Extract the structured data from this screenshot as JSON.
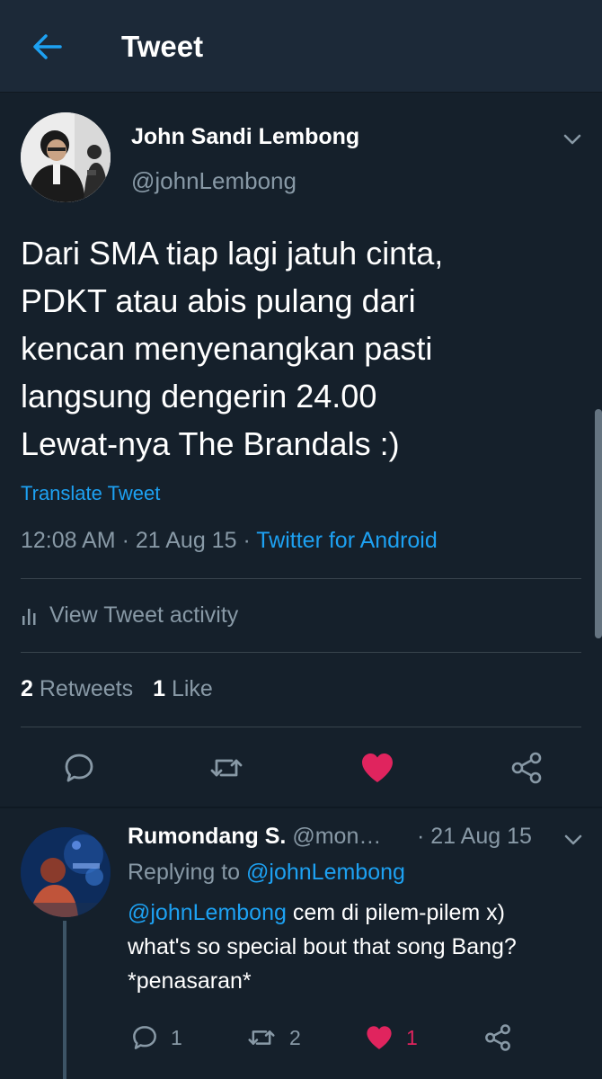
{
  "topbar": {
    "title": "Tweet",
    "back_icon": "arrow-left-icon"
  },
  "tweet": {
    "author_name": "John Sandi Lembong",
    "author_handle": "@johnLembong",
    "text_lines": [
      "Dari SMA tiap lagi jatuh cinta,",
      "PDKT atau abis pulang dari",
      "kencan menyenangkan pasti",
      "langsung dengerin 24.00",
      "Lewat-nya The Brandals :)"
    ],
    "translate_label": "Translate Tweet",
    "time": "12:08 AM",
    "date": "21 Aug 15",
    "source": "Twitter for Android",
    "activity_label": "View Tweet activity",
    "retweet_count": "2",
    "retweets_label": "Retweets",
    "like_count": "1",
    "like_label": "Like",
    "liked": true
  },
  "reply": {
    "author_name": "Rumondang S.",
    "author_handle": "@mon…",
    "date": "· 21 Aug 15",
    "replying_prefix": "Replying to",
    "replying_to": "@johnLembong",
    "mention": "@johnLembong",
    "text_line1": " cem di pilem-pilem x)",
    "text_line2": "what's so special bout that song Bang?",
    "text_line3": "*penasaran*",
    "reply_count": "1",
    "retweet_count": "2",
    "like_count": "1"
  },
  "colors": {
    "background": "#15202b",
    "topbar": "#1c2938",
    "accent_blue": "#1da1f2",
    "secondary_text": "#8899a6",
    "like_red": "#e0245e"
  }
}
